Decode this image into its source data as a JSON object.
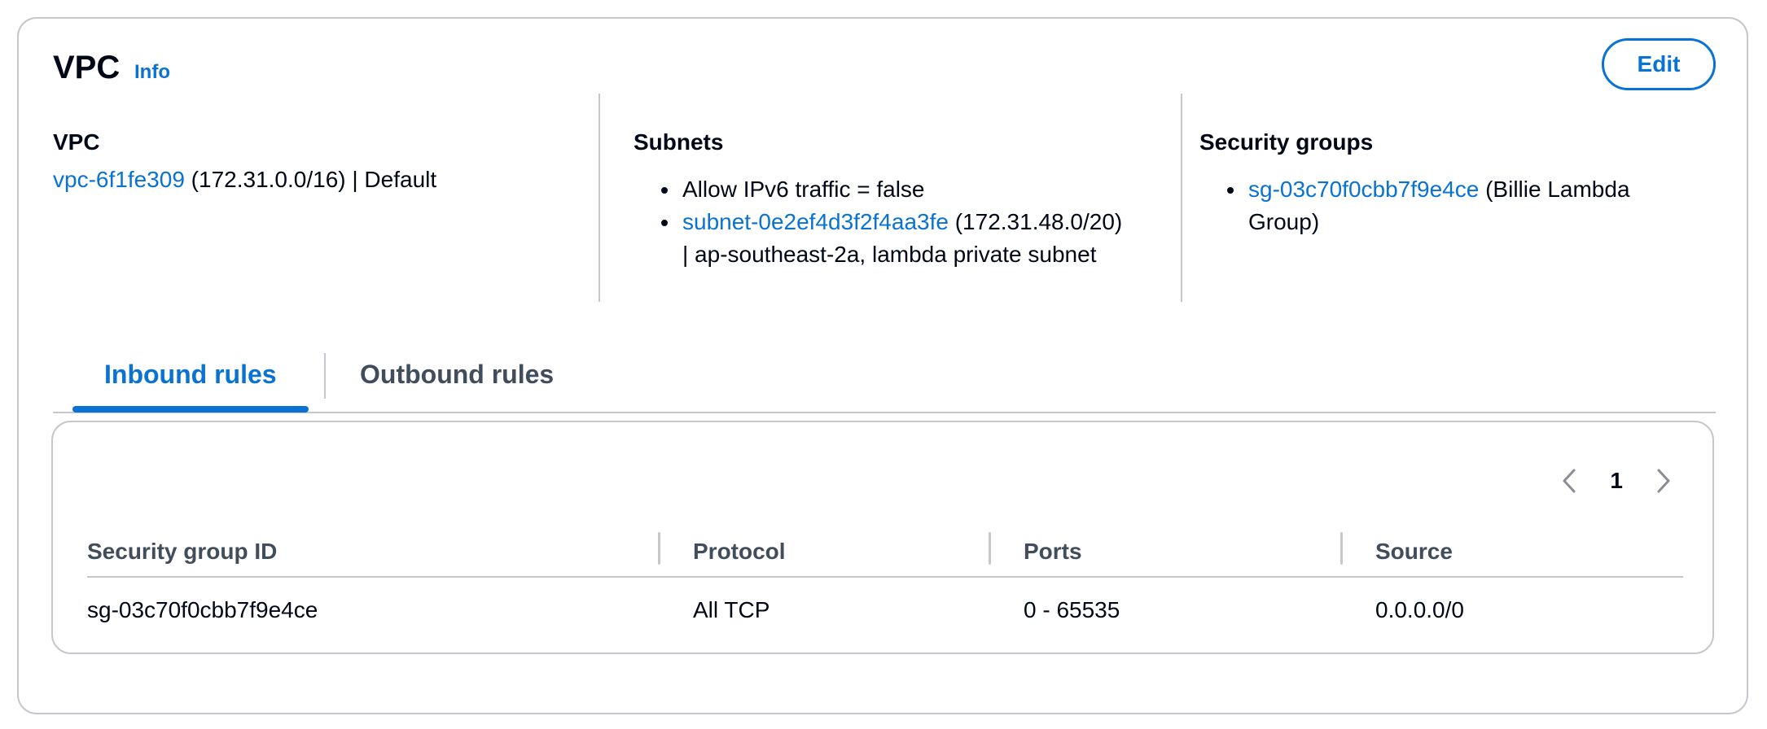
{
  "header": {
    "title": "VPC",
    "info": "Info",
    "edit": "Edit"
  },
  "vpc": {
    "label": "VPC",
    "id": "vpc-6f1fe309",
    "detail": " (172.31.0.0/16) | Default"
  },
  "subnets": {
    "label": "Subnets",
    "items": [
      {
        "text": "Allow IPv6 traffic = false"
      },
      {
        "link": "subnet-0e2ef4d3f2f4aa3fe",
        "text": " (172.31.48.0/20)",
        "text2": "| ap-southeast-2a, lambda private subnet"
      }
    ]
  },
  "security_groups": {
    "label": "Security groups",
    "items": [
      {
        "link": "sg-03c70f0cbb7f9e4ce",
        "text": " (Billie Lambda",
        "text2": "Group)"
      }
    ]
  },
  "tabs": [
    {
      "label": "Inbound rules",
      "active": true
    },
    {
      "label": "Outbound rules",
      "active": false
    }
  ],
  "pagination": {
    "page": "1"
  },
  "table": {
    "columns": [
      "Security group ID",
      "Protocol",
      "Ports",
      "Source"
    ],
    "rows": [
      [
        "sg-03c70f0cbb7f9e4ce",
        "All TCP",
        "0 - 65535",
        "0.0.0.0/0"
      ]
    ]
  },
  "colors": {
    "accent": "#0972d3",
    "border": "#c6c6cd",
    "text": "#000716"
  },
  "icons": {
    "prev": "chevron-left-icon",
    "next": "chevron-right-icon"
  }
}
